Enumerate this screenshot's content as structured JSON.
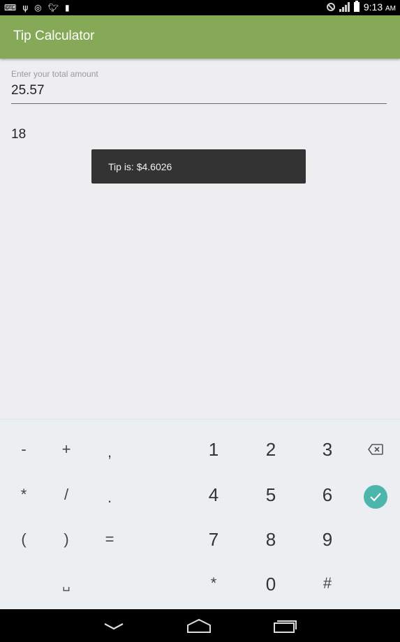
{
  "status_bar": {
    "time": "9:13",
    "ampm": "AM",
    "notification_icons": [
      "keyboard-icon",
      "usb-icon",
      "instagram-icon",
      "twitter-icon",
      "document-icon"
    ]
  },
  "app_bar": {
    "title": "Tip Calculator",
    "color": "#85a957"
  },
  "form": {
    "amount_label": "Enter your total amount",
    "amount_value": "25.57",
    "tip_percent": "18"
  },
  "toast": {
    "text": "Tip is: $4.6026"
  },
  "keyboard": {
    "row1": [
      "-",
      "+",
      ",",
      "1",
      "2",
      "3"
    ],
    "row2": [
      "*",
      "/",
      ".",
      "4",
      "5",
      "6"
    ],
    "row3": [
      "(",
      ")",
      "=",
      "7",
      "8",
      "9"
    ],
    "row4": [
      "*",
      "0",
      "#"
    ],
    "space_key": "␣",
    "accent": "#4db6ac"
  },
  "nav_bar": {
    "buttons": [
      "back-icon",
      "home-icon",
      "recents-icon"
    ]
  }
}
